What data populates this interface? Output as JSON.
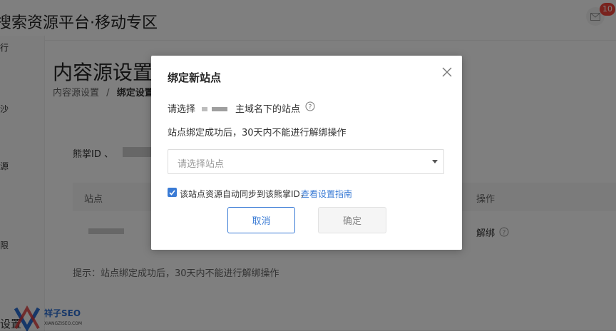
{
  "header": {
    "app_title": "搜索资源平台·移动专区",
    "notification_count": "10"
  },
  "sidebar": {
    "items": [
      "行",
      "沙",
      "源",
      "限",
      "设置"
    ]
  },
  "main": {
    "page_title": "内容源设置",
    "breadcrumb": {
      "parent": "内容源设置",
      "separator": "/",
      "current": "绑定设置"
    },
    "xiongzhang_label": "熊掌ID 、",
    "table": {
      "headers": [
        "站点",
        "操作"
      ],
      "row_action": "解绑"
    },
    "tip": "提示：站点绑定成功后，30天内不能进行解绑操作"
  },
  "watermark": {
    "brand": "祥子SEO",
    "sub": "XIANGZISEO.COM"
  },
  "modal": {
    "title": "绑定新站点",
    "prompt_prefix": "请选择",
    "prompt_suffix": "主域名下的站点",
    "notice": "站点绑定成功后，30天内不能进行解绑操作",
    "select_placeholder": "请选择站点",
    "sync_checkbox_label": "该站点资源自动同步到该熊掌ID，",
    "sync_checked": true,
    "guide_link": "查看设置指南",
    "cancel_label": "取消",
    "confirm_label": "确定"
  },
  "colors": {
    "accent": "#3a7bd5",
    "badge": "#f2473d"
  },
  "icons": [
    "mail-icon",
    "close-icon",
    "help-icon",
    "check-icon",
    "dropdown-arrow-icon"
  ]
}
